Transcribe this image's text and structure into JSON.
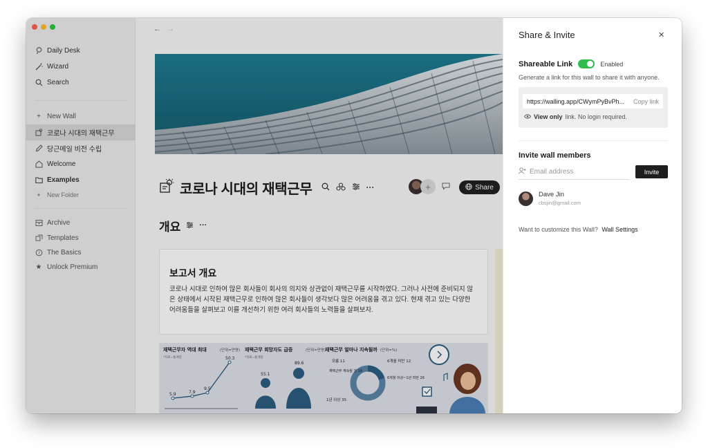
{
  "sidebar": {
    "primary": [
      {
        "label": "Daily Desk",
        "icon": "daily-desk-icon"
      },
      {
        "label": "Wizard",
        "icon": "wand-icon"
      },
      {
        "label": "Search",
        "icon": "search-icon"
      }
    ],
    "new_wall": "New Wall",
    "walls": [
      {
        "label": "코로나 시대의 재택근무",
        "icon": "wall-icon",
        "active": true
      },
      {
        "label": "당근메일 비전 수립",
        "icon": "pen-icon"
      },
      {
        "label": "Welcome",
        "icon": "home-icon"
      },
      {
        "label": "Examples",
        "icon": "folder-icon",
        "bold": true
      }
    ],
    "new_folder": "New Folder",
    "secondary": [
      {
        "label": "Archive",
        "icon": "archive-icon"
      },
      {
        "label": "Templates",
        "icon": "templates-icon"
      },
      {
        "label": "The Basics",
        "icon": "help-icon"
      },
      {
        "label": "Unlock Premium",
        "icon": "star-icon"
      }
    ]
  },
  "main": {
    "wall_title": "코로나 시대의 재택근무",
    "share_label": "Share",
    "section_title": "개요",
    "card": {
      "title": "보고서 개요",
      "body": "코로나 시대로 인하여 많은 회사들이 회사의 의지와 상관없이 재택근무를 시작하였다. 그러나 사전에 준비되지 않은 상태에서 시작된 재택근무로 인하여 많은 회사들이 생각보다 많은 어려움을 겪고 있다. 현재 겪고 있는 다양한 어려움들을 살펴보고 이를 개선하기 위한 여러 회사들의 노력들을 살펴보자."
    },
    "infographic": {
      "panel1_title": "재택근무자 역대 최대",
      "panel1_unit": "(단위=만명)",
      "panel1_note": "*자료=통계청",
      "panel1_values": [
        "5.9",
        "7.9",
        "9.5",
        "50.3"
      ],
      "panel2_title": "재택근무 희망자도 급증",
      "panel2_unit": "(단위=만명)",
      "panel2_note": "*자료=통계청",
      "panel2_values": [
        "55.1",
        "89.6"
      ],
      "panel3_title": "재택근무 얼마나 지속될까",
      "panel3_unit": "(단위=%)",
      "panel3_labels": [
        "모름 11",
        "6개월 미만 12",
        "재택근무 계속될 것 16",
        "6개월 이상~1년 미만 26",
        "1년 이상 35"
      ]
    }
  },
  "share_panel": {
    "title": "Share & Invite",
    "shareable_link_label": "Shareable Link",
    "toggle_label": "Enabled",
    "description": "Generate a link for this wall to share it with anyone.",
    "url": "https://walling.app/CWymPyBvPh...",
    "copy_label": "Copy link",
    "view_only_bold": "View only",
    "view_only_rest": "link. No login required.",
    "invite_title": "Invite wall members",
    "email_placeholder": "Email address",
    "invite_button": "Invite",
    "member": {
      "name": "Dave Jin",
      "email": "cbsjin@gmail.com"
    },
    "customize_text": "Want to customize this Wall?",
    "customize_link": "Wall Settings"
  },
  "colors": {
    "toggle_on": "#2ebc4f",
    "cover": "#1b6e83",
    "share_button": "#222222"
  }
}
